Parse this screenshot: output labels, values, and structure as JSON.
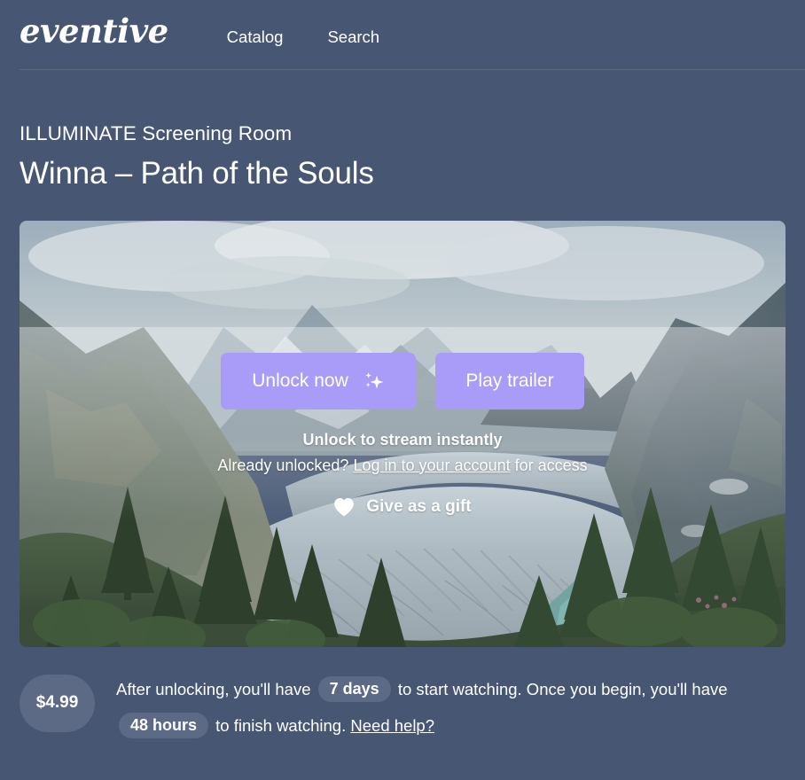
{
  "brand": {
    "logo_text": "eventive"
  },
  "nav": {
    "items": [
      {
        "label": "Catalog"
      },
      {
        "label": "Search"
      }
    ]
  },
  "page": {
    "eyebrow": "ILLUMINATE Screening Room",
    "title": "Winna – Path of the Souls"
  },
  "hero": {
    "image_alt": "Mountain valley with glacier, pine trees and turquoise lake",
    "buttons": {
      "unlock_label": "Unlock now",
      "unlock_icon": "sparkles-icon",
      "trailer_label": "Play trailer"
    },
    "note": "Unlock to stream instantly",
    "sub_prefix": "Already unlocked?",
    "sub_link": "Log in to your account",
    "sub_suffix": "for access",
    "gift": {
      "icon": "heart-icon",
      "label": "Give as a gift"
    }
  },
  "footer": {
    "price": "$4.99",
    "text_part1": "After unlocking, you'll have",
    "chip_start": "7 days",
    "text_part2": "to start watching. Once you begin, you'll have",
    "chip_finish": "48 hours",
    "text_part3": "to finish watching.",
    "help_link": "Need help?"
  },
  "colors": {
    "background": "#475673",
    "accent_purple": "#a99bf8",
    "badge_gray": "#5c6a85",
    "divider": "#5a6880",
    "text": "#ffffff"
  }
}
